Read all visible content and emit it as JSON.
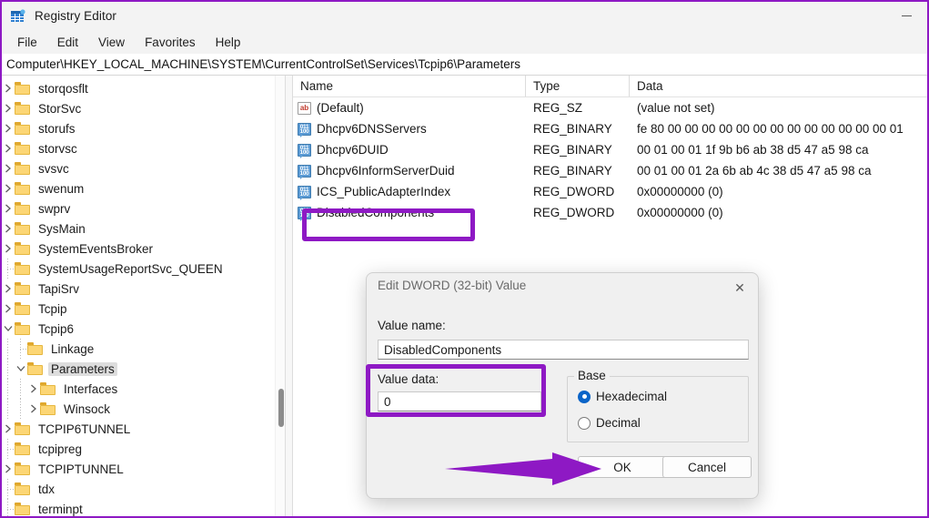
{
  "window": {
    "title": "Registry Editor",
    "icon": "registry-editor-icon",
    "minimize_label": "Minimize"
  },
  "menubar": {
    "items": [
      {
        "label": "File"
      },
      {
        "label": "Edit"
      },
      {
        "label": "View"
      },
      {
        "label": "Favorites"
      },
      {
        "label": "Help"
      }
    ]
  },
  "addressbar": {
    "path": "Computer\\HKEY_LOCAL_MACHINE\\SYSTEM\\CurrentControlSet\\Services\\Tcpip6\\Parameters"
  },
  "tree": {
    "items": [
      {
        "label": "storqosflt",
        "indent": 1,
        "expander": "collapsed"
      },
      {
        "label": "StorSvc",
        "indent": 1,
        "expander": "collapsed"
      },
      {
        "label": "storufs",
        "indent": 1,
        "expander": "collapsed"
      },
      {
        "label": "storvsc",
        "indent": 1,
        "expander": "collapsed"
      },
      {
        "label": "svsvc",
        "indent": 1,
        "expander": "collapsed"
      },
      {
        "label": "swenum",
        "indent": 1,
        "expander": "collapsed"
      },
      {
        "label": "swprv",
        "indent": 1,
        "expander": "collapsed"
      },
      {
        "label": "SysMain",
        "indent": 1,
        "expander": "collapsed"
      },
      {
        "label": "SystemEventsBroker",
        "indent": 1,
        "expander": "collapsed"
      },
      {
        "label": "SystemUsageReportSvc_QUEEN",
        "indent": 1,
        "expander": "leaf"
      },
      {
        "label": "TapiSrv",
        "indent": 1,
        "expander": "collapsed"
      },
      {
        "label": "Tcpip",
        "indent": 1,
        "expander": "collapsed"
      },
      {
        "label": "Tcpip6",
        "indent": 1,
        "expander": "expanded"
      },
      {
        "label": "Linkage",
        "indent": 2,
        "expander": "leaf"
      },
      {
        "label": "Parameters",
        "indent": 2,
        "expander": "expanded",
        "selected": true
      },
      {
        "label": "Interfaces",
        "indent": 3,
        "expander": "collapsed"
      },
      {
        "label": "Winsock",
        "indent": 3,
        "expander": "collapsed"
      },
      {
        "label": "TCPIP6TUNNEL",
        "indent": 1,
        "expander": "collapsed"
      },
      {
        "label": "tcpipreg",
        "indent": 1,
        "expander": "leaf"
      },
      {
        "label": "TCPIPTUNNEL",
        "indent": 1,
        "expander": "collapsed"
      },
      {
        "label": "tdx",
        "indent": 1,
        "expander": "leaf"
      },
      {
        "label": "terminpt",
        "indent": 1,
        "expander": "leaf"
      }
    ]
  },
  "list": {
    "columns": [
      "Name",
      "Type",
      "Data"
    ],
    "rows": [
      {
        "icon": "string-value-icon",
        "name": "(Default)",
        "type": "REG_SZ",
        "data": "(value not set)"
      },
      {
        "icon": "binary-value-icon",
        "name": "Dhcpv6DNSServers",
        "type": "REG_BINARY",
        "data": "fe 80 00 00 00 00 00 00 00 00 00 00 00 00 00 01"
      },
      {
        "icon": "binary-value-icon",
        "name": "Dhcpv6DUID",
        "type": "REG_BINARY",
        "data": "00 01 00 01 1f 9b b6 ab 38 d5 47 a5 98 ca"
      },
      {
        "icon": "binary-value-icon",
        "name": "Dhcpv6InformServerDuid",
        "type": "REG_BINARY",
        "data": "00 01 00 01 2a 6b ab 4c 38 d5 47 a5 98 ca"
      },
      {
        "icon": "binary-value-icon",
        "name": "ICS_PublicAdapterIndex",
        "type": "REG_DWORD",
        "data": "0x00000000 (0)"
      },
      {
        "icon": "binary-value-icon",
        "name": "DisabledComponents",
        "type": "REG_DWORD",
        "data": "0x00000000 (0)"
      }
    ]
  },
  "dialog": {
    "title": "Edit DWORD (32-bit) Value",
    "close_label": "✕",
    "value_name_label": "Value name:",
    "value_name": "DisabledComponents",
    "value_data_label": "Value data:",
    "value_data": "0",
    "base_legend": "Base",
    "base_options": [
      {
        "label": "Hexadecimal",
        "selected": true
      },
      {
        "label": "Decimal",
        "selected": false
      }
    ],
    "ok_label": "OK",
    "cancel_label": "Cancel"
  },
  "annotations": {
    "accent_color": "#8e19c4",
    "highlight_disabled_components": "DisabledComponents",
    "highlight_value_data": "Value data:",
    "arrow_points_to": "OK"
  }
}
